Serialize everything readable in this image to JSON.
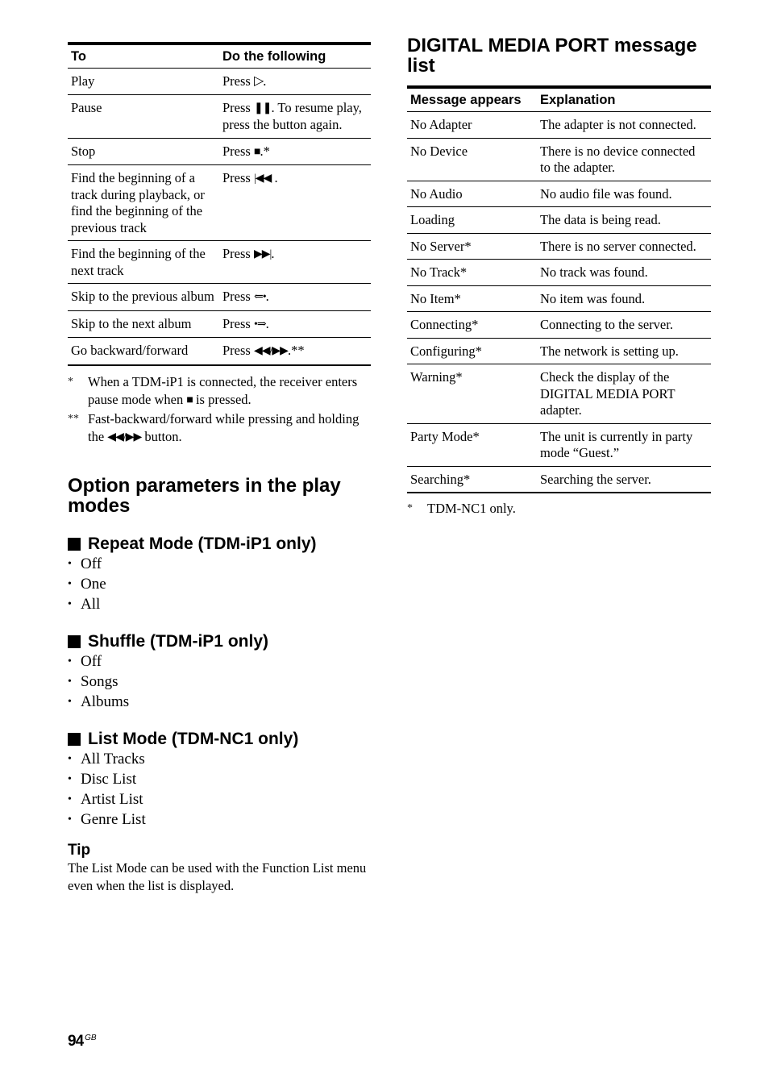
{
  "playback_table": {
    "headers": [
      "To",
      "Do the following"
    ],
    "rows": [
      {
        "action": "Play",
        "pre": "Press ",
        "icon": "▷",
        "icon_name": "play-icon",
        "post": "."
      },
      {
        "action": "Pause",
        "pre": "Press ",
        "icon": "❚❚",
        "icon_name": "pause-icon",
        "post": ". To resume play, press the button again."
      },
      {
        "action": "Stop",
        "pre": "Press ",
        "icon": "■",
        "icon_name": "stop-icon",
        "post": ".*"
      },
      {
        "action": "Find the beginning of a track during playback, or find the beginning of the previous track",
        "pre": "Press ",
        "icon": "|◀◀",
        "icon_name": "previous-track-icon",
        "post": " ."
      },
      {
        "action": "Find the beginning of the next track",
        "pre": "Press ",
        "icon": "▶▶|",
        "icon_name": "next-track-icon",
        "post": "."
      },
      {
        "action": "Skip to the previous album",
        "pre": "Press ",
        "icon": "⇐•",
        "icon_name": "previous-album-icon",
        "post": "."
      },
      {
        "action": "Skip to the next album",
        "pre": "Press ",
        "icon": "•⇒",
        "icon_name": "next-album-icon",
        "post": "."
      },
      {
        "action": "Go backward/forward",
        "pre": "Press ",
        "icon": "◀◀/▶▶",
        "icon_name": "rewind-fastforward-icon",
        "post": ".**"
      }
    ]
  },
  "playback_footnotes": [
    {
      "mark": "*",
      "pre": "When a TDM-iP1 is connected, the receiver enters pause mode when ",
      "icon": "■",
      "post": " is pressed."
    },
    {
      "mark": "**",
      "pre": "Fast-backward/forward while pressing and holding the ",
      "icon": "◀◀/▶▶",
      "post": " button."
    }
  ],
  "options_section": {
    "title": "Option parameters in the play modes",
    "groups": [
      {
        "title": "Repeat Mode (TDM-iP1 only)",
        "items": [
          "Off",
          "One",
          "All"
        ]
      },
      {
        "title": "Shuffle (TDM-iP1 only)",
        "items": [
          "Off",
          "Songs",
          "Albums"
        ]
      },
      {
        "title": "List Mode (TDM-NC1 only)",
        "items": [
          "All Tracks",
          "Disc List",
          "Artist List",
          "Genre List"
        ]
      }
    ],
    "tip_title": "Tip",
    "tip_text": "The List Mode can be used with the Function List menu even when the list is displayed."
  },
  "message_section": {
    "title": "DIGITAL MEDIA PORT message list",
    "headers": [
      "Message appears",
      "Explanation"
    ],
    "rows": [
      [
        "No Adapter",
        "The adapter is not connected."
      ],
      [
        "No Device",
        "There is no device connected to the adapter."
      ],
      [
        "No Audio",
        "No audio file was found."
      ],
      [
        "Loading",
        "The data is being read."
      ],
      [
        "No Server*",
        "There is no server connected."
      ],
      [
        "No Track*",
        "No track was found."
      ],
      [
        "No Item*",
        "No item was found."
      ],
      [
        "Connecting*",
        "Connecting to the server."
      ],
      [
        "Configuring*",
        "The network is setting up."
      ],
      [
        "Warning*",
        "Check the display of the DIGITAL MEDIA PORT adapter."
      ],
      [
        "Party Mode*",
        "The unit is currently in party mode “Guest.”"
      ],
      [
        "Searching*",
        "Searching the server."
      ]
    ],
    "footnote_mark": "*",
    "footnote_text": "TDM-NC1 only."
  },
  "page": {
    "number": "94",
    "region": "GB"
  },
  "bullet_char": "•"
}
